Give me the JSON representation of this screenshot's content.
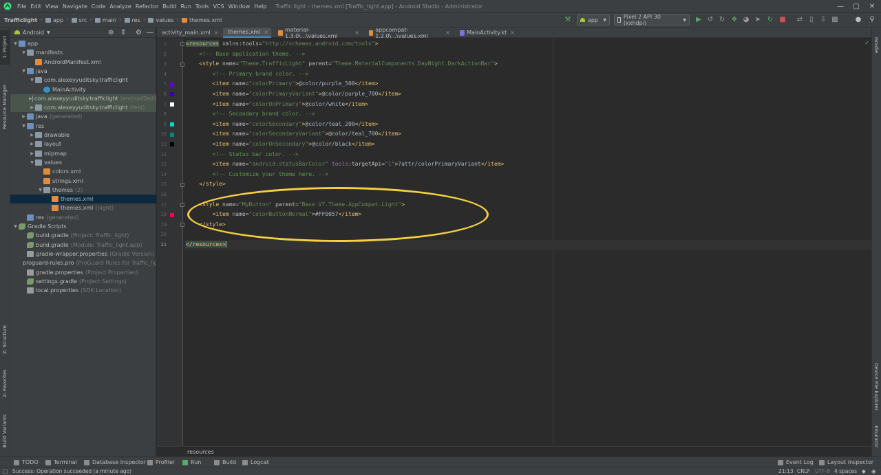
{
  "menubar": {
    "items": [
      "File",
      "Edit",
      "View",
      "Navigate",
      "Code",
      "Analyze",
      "Refactor",
      "Build",
      "Run",
      "Tools",
      "VCS",
      "Window",
      "Help"
    ],
    "title": "Traffic light - themes.xml [Traffic_light.app] - Android Studio - Administrator"
  },
  "navbar": {
    "crumbs": [
      "Trafficlight",
      "app",
      "src",
      "main",
      "res",
      "values",
      "themes.xml"
    ],
    "run_config": "app",
    "device": "Pixel 2 API 30 (xxhdpi)"
  },
  "project_panel": {
    "view_mode": "Android",
    "tree": [
      {
        "label": "app",
        "hint": "",
        "icon": "folder-blue"
      },
      {
        "label": "manifests",
        "hint": "",
        "icon": "folder"
      },
      {
        "label": "AndroidManifest.xml",
        "hint": "",
        "icon": "xml"
      },
      {
        "label": "java",
        "hint": "",
        "icon": "folder-blue"
      },
      {
        "label": "com.alexeyyuditsky.trafficlight",
        "hint": "",
        "icon": "folder"
      },
      {
        "label": "MainActivity",
        "hint": "",
        "icon": "class"
      },
      {
        "label": "com.alexeyyuditsky.trafficlight",
        "hint": "(androidTest)",
        "icon": "folder"
      },
      {
        "label": "com.alexeyyuditsky.trafficlight",
        "hint": "(test)",
        "icon": "folder"
      },
      {
        "label": "java",
        "hint": "(generated)",
        "icon": "folder-blue"
      },
      {
        "label": "res",
        "hint": "",
        "icon": "folder-blue"
      },
      {
        "label": "drawable",
        "hint": "",
        "icon": "folder"
      },
      {
        "label": "layout",
        "hint": "",
        "icon": "folder"
      },
      {
        "label": "mipmap",
        "hint": "",
        "icon": "folder"
      },
      {
        "label": "values",
        "hint": "",
        "icon": "folder"
      },
      {
        "label": "colors.xml",
        "hint": "",
        "icon": "xml"
      },
      {
        "label": "strings.xml",
        "hint": "",
        "icon": "xml"
      },
      {
        "label": "themes",
        "hint": "(2)",
        "icon": "folder"
      },
      {
        "label": "themes.xml",
        "hint": "",
        "icon": "xml"
      },
      {
        "label": "themes.xml",
        "hint": "(night)",
        "icon": "xml"
      },
      {
        "label": "res",
        "hint": "(generated)",
        "icon": "folder-blue"
      },
      {
        "label": "Gradle Scripts",
        "hint": "",
        "icon": "gradle"
      },
      {
        "label": "build.gradle",
        "hint": "(Project: Traffic_light)",
        "icon": "gradle"
      },
      {
        "label": "build.gradle",
        "hint": "(Module: Traffic_light.app)",
        "icon": "gradle"
      },
      {
        "label": "gradle-wrapper.properties",
        "hint": "(Gradle Version)",
        "icon": "props"
      },
      {
        "label": "proguard-rules.pro",
        "hint": "(ProGuard Rules for Traffic_lig",
        "icon": "props"
      },
      {
        "label": "gradle.properties",
        "hint": "(Project Properties)",
        "icon": "props"
      },
      {
        "label": "settings.gradle",
        "hint": "(Project Settings)",
        "icon": "gradle"
      },
      {
        "label": "local.properties",
        "hint": "(SDK Location)",
        "icon": "props"
      }
    ]
  },
  "side_tabs": {
    "project": "1: Project",
    "resource_manager": "Resource Manager",
    "structure": "Z: Structure",
    "favorites": "2: Favorites",
    "build_variants": "Build Variants",
    "gradle": "Gradle",
    "device_file_explorer": "Device File Explorer",
    "emulator": "Emulator"
  },
  "tabs": [
    {
      "label": "activity_main.xml",
      "icon": "xml"
    },
    {
      "label": "themes.xml",
      "icon": "xml"
    },
    {
      "label": "material-1.3.0\\...\\values.xml",
      "icon": "xml"
    },
    {
      "label": "appcompat-1.2.0\\...\\values.xml",
      "icon": "xml"
    },
    {
      "label": "MainActivity.kt",
      "icon": "kt"
    }
  ],
  "editor": {
    "line_numbers": [
      "1",
      "2",
      "3",
      "4",
      "5",
      "6",
      "7",
      "8",
      "9",
      "10",
      "11",
      "12",
      "13",
      "14",
      "15",
      "16",
      "17",
      "18",
      "19",
      "20",
      "21"
    ],
    "swatches": {
      "5": "#6200ee",
      "6": "#3700b3",
      "7": "#ffffff",
      "9": "#03dac5",
      "10": "#018786",
      "11": "#000000",
      "18": "#ff0057"
    },
    "lines": [
      [
        [
          "tag-hl",
          "<resources"
        ],
        [
          "attr",
          " xmlns:tools="
        ],
        [
          "str",
          "\"http://schemas.android.com/tools\""
        ],
        [
          "tag",
          ">"
        ]
      ],
      [
        [
          "cmt",
          "    <!-- Base application theme. -->"
        ]
      ],
      [
        [
          "tag",
          "    <style "
        ],
        [
          "attr",
          "name="
        ],
        [
          "str",
          "\"Theme.TrafficLight\""
        ],
        [
          "attr",
          " parent="
        ],
        [
          "str",
          "\"Theme.MaterialComponents.DayNight.DarkActionBar\""
        ],
        [
          "tag",
          ">"
        ]
      ],
      [
        [
          "cmt",
          "        <!-- Primary brand color. -->"
        ]
      ],
      [
        [
          "tag",
          "        <item "
        ],
        [
          "attr",
          "name="
        ],
        [
          "str",
          "\"colorPrimary\""
        ],
        [
          "tag",
          ">"
        ],
        [
          "txt",
          "@color/purple_500"
        ],
        [
          "tag",
          "</item>"
        ]
      ],
      [
        [
          "tag",
          "        <item "
        ],
        [
          "attr",
          "name="
        ],
        [
          "str",
          "\"colorPrimaryVariant\""
        ],
        [
          "tag",
          ">"
        ],
        [
          "txt",
          "@color/purple_700"
        ],
        [
          "tag",
          "</item>"
        ]
      ],
      [
        [
          "tag",
          "        <item "
        ],
        [
          "attr",
          "name="
        ],
        [
          "str",
          "\"colorOnPrimary\""
        ],
        [
          "tag",
          ">"
        ],
        [
          "txt",
          "@color/white"
        ],
        [
          "tag",
          "</item>"
        ]
      ],
      [
        [
          "cmt",
          "        <!-- Secondary brand color. -->"
        ]
      ],
      [
        [
          "tag",
          "        <item "
        ],
        [
          "attr",
          "name="
        ],
        [
          "str",
          "\"colorSecondary\""
        ],
        [
          "tag",
          ">"
        ],
        [
          "txt",
          "@color/teal_200"
        ],
        [
          "tag",
          "</item>"
        ]
      ],
      [
        [
          "tag",
          "        <item "
        ],
        [
          "attr",
          "name="
        ],
        [
          "str",
          "\"colorSecondaryVariant\""
        ],
        [
          "tag",
          ">"
        ],
        [
          "txt",
          "@color/teal_700"
        ],
        [
          "tag",
          "</item>"
        ]
      ],
      [
        [
          "tag",
          "        <item "
        ],
        [
          "attr",
          "name="
        ],
        [
          "str",
          "\"colorOnSecondary\""
        ],
        [
          "tag",
          ">"
        ],
        [
          "txt",
          "@color/black"
        ],
        [
          "tag",
          "</item>"
        ]
      ],
      [
        [
          "cmt",
          "        <!-- Status bar color. -->"
        ]
      ],
      [
        [
          "tag",
          "        <item "
        ],
        [
          "attr",
          "name="
        ],
        [
          "str",
          "\"android:statusBarColor\""
        ],
        [
          "ns",
          " tools"
        ],
        [
          "attr",
          ":targetApi="
        ],
        [
          "str",
          "\"l\""
        ],
        [
          "tag",
          ">"
        ],
        [
          "txt",
          "?attr/colorPrimaryVariant"
        ],
        [
          "tag",
          "</item>"
        ]
      ],
      [
        [
          "cmt",
          "        <!-- Customize your theme here. -->"
        ]
      ],
      [
        [
          "tag",
          "    </style>"
        ]
      ],
      [],
      [
        [
          "tag",
          "    <style "
        ],
        [
          "attr",
          "name="
        ],
        [
          "str",
          "\"MyButton\""
        ],
        [
          "attr",
          " parent="
        ],
        [
          "str",
          "\"Base.V7.Theme.AppCompat.Light\""
        ],
        [
          "tag",
          ">"
        ]
      ],
      [
        [
          "tag",
          "        <item "
        ],
        [
          "attr",
          "name="
        ],
        [
          "str",
          "\"colorButtonNormal\""
        ],
        [
          "tag",
          ">"
        ],
        [
          "txt",
          "#FF0057"
        ],
        [
          "tag",
          "</item>"
        ]
      ],
      [
        [
          "tag",
          "    </style>"
        ]
      ],
      [],
      [
        [
          "tag-hlcur",
          "</resources>"
        ]
      ]
    ],
    "breadcrumb": "resources"
  },
  "bottom_tools": [
    "TODO",
    "Terminal",
    "Database Inspector",
    "Profiler",
    "Run",
    "Build",
    "Logcat",
    "Event Log",
    "Layout Inspector"
  ],
  "status": {
    "message": "Success: Operation succeeded (a minute ago)",
    "position": "21:13",
    "line_sep": "CRLF",
    "encoding": "UTF-8",
    "indent": "4 spaces"
  }
}
